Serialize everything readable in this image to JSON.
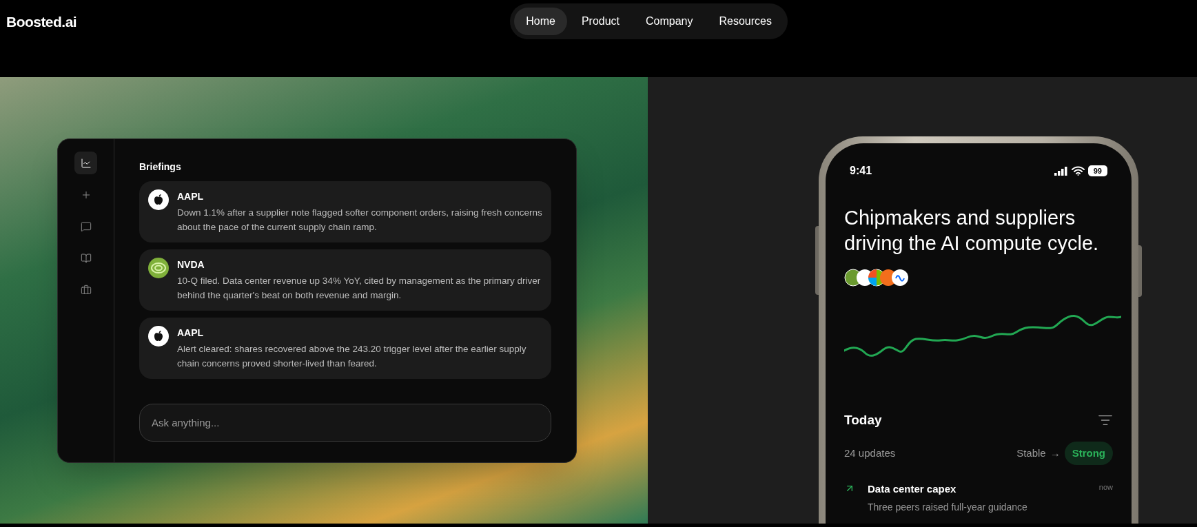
{
  "logo": "Boosted.ai",
  "nav": [
    {
      "label": "Home",
      "selected": true
    },
    {
      "label": "Product",
      "selected": false
    },
    {
      "label": "Company",
      "selected": false
    },
    {
      "label": "Resources",
      "selected": false
    }
  ],
  "app_window": {
    "sidebar": {
      "items": [
        {
          "selected": true
        },
        {
          "selected": false
        },
        {
          "selected": false
        },
        {
          "selected": false
        },
        {
          "selected": false
        }
      ]
    },
    "title": "Briefings",
    "briefings": [
      {
        "kind": "light",
        "ticker": "AAPL",
        "text": "Down 1.1% after a supplier note flagged softer component orders, raising fresh concerns about the pace of the current supply chain ramp."
      },
      {
        "kind": "green",
        "ticker": "NVDA",
        "text": "10-Q filed. Data center revenue up 34% YoY, cited by management as the primary driver behind the quarter's beat on both revenue and margin."
      },
      {
        "kind": "light",
        "ticker": "AAPL",
        "text": "Alert cleared: shares recovered above the 243.20 trigger level after the earlier supply chain concerns proved shorter-lived than feared."
      }
    ],
    "input": {
      "placeholder": "Ask anything..."
    }
  },
  "phone": {
    "status_bar": {
      "time": "9:41",
      "battery": "99"
    },
    "headline": "Chipmakers and suppliers driving the AI compute cycle.",
    "section_title": "Today",
    "updates_count": "24 updates",
    "trend_from": "Stable",
    "trend_arrow": "→",
    "trend_to": "Strong",
    "feed": [
      {
        "title": "Data center capex",
        "time": "now",
        "subtitle": "Three peers raised full-year guidance"
      }
    ]
  }
}
